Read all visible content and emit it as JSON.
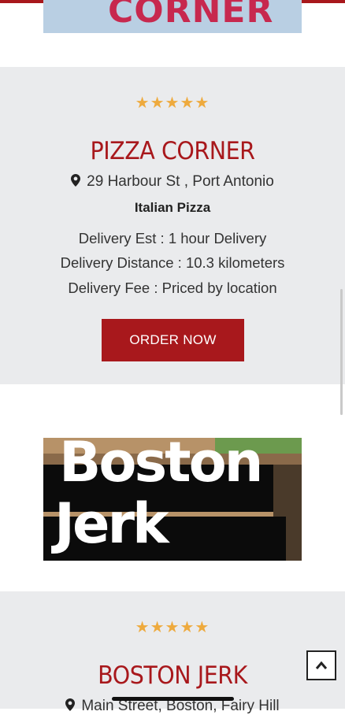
{
  "restaurants": [
    {
      "logo_text": "CORNER",
      "rating_stars": "★★★★★",
      "rating": 5,
      "name": "PIZZA CORNER",
      "address": "29 Harbour St , Port Antonio",
      "cuisine": "Italian Pizza",
      "delivery_est": "Delivery Est : 1 hour Delivery",
      "delivery_distance": "Delivery Distance : 10.3 kilometers",
      "delivery_fee": "Delivery Fee : Priced by location",
      "order_label": "ORDER NOW"
    },
    {
      "logo_text_line1": "Boston",
      "logo_text_line2": "Jerk",
      "rating_stars": "★★★★★",
      "rating": 5,
      "name": "BOSTON JERK",
      "address": "Main Street, Boston, Fairy Hill"
    }
  ],
  "colors": {
    "accent": "#a8181c",
    "star": "#eeaa3e",
    "card_bg": "#eaebed"
  },
  "icons": {
    "address": "map-pin-icon",
    "scroll_top": "chevron-up-icon"
  }
}
